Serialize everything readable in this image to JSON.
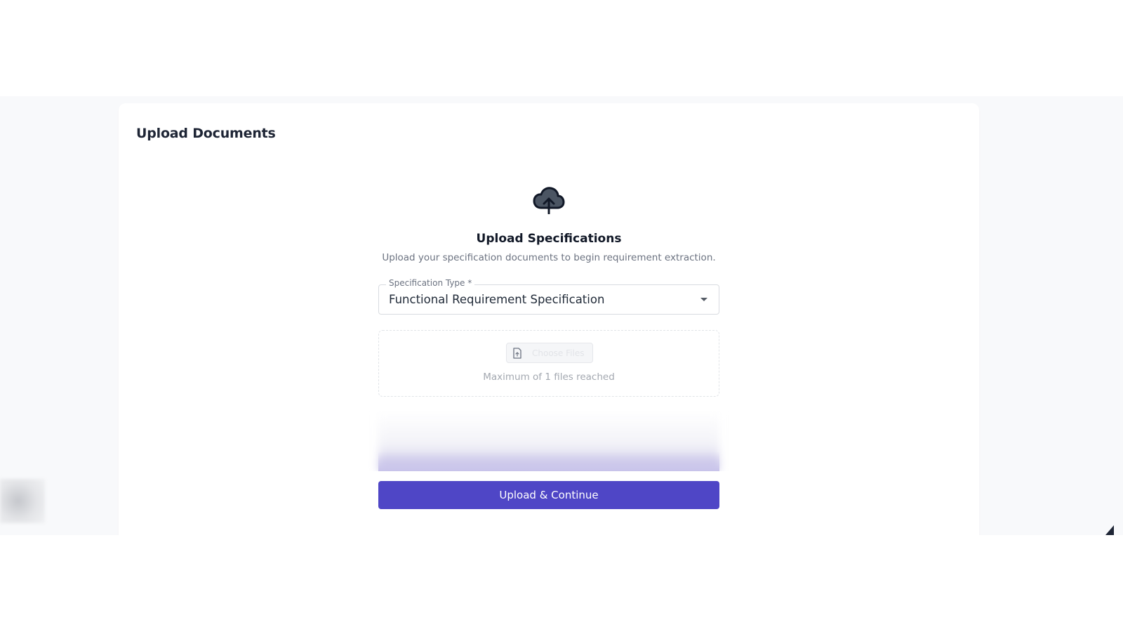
{
  "page": {
    "title": "Upload Documents"
  },
  "upload": {
    "icon": "cloud-upload-icon",
    "title": "Upload Specifications",
    "subtitle": "Upload your specification documents to begin requirement extraction.",
    "spec_type": {
      "label": "Specification Type *",
      "value": "Functional Requirement Specification"
    },
    "dropzone": {
      "button_icon": "file-icon",
      "button_label": "Choose Files",
      "note": "Maximum of 1 files reached"
    },
    "submit_label": "Upload & Continue"
  },
  "colors": {
    "accent": "#4f46c6",
    "background": "#f8f9fb",
    "card": "#ffffff"
  }
}
